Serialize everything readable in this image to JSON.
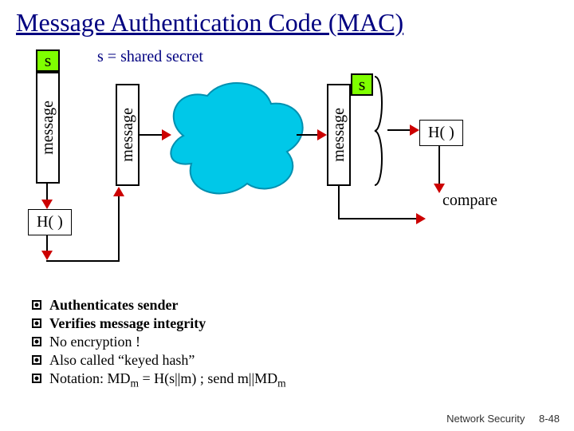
{
  "title": "Message Authentication Code (MAC)",
  "subtitle": "s = shared secret",
  "labels": {
    "s": "s",
    "message": "message",
    "hash": "H( )",
    "compare": "compare"
  },
  "bullets": [
    {
      "text": "Authenticates sender",
      "bold": true
    },
    {
      "text": "Verifies message integrity",
      "bold": true
    },
    {
      "text": "No encryption !",
      "bold": false
    },
    {
      "text": "Also called “keyed hash”",
      "bold": false
    },
    {
      "text": "Notation: MD",
      "sub": "m",
      "rest": " = H(s||m) ; send m||MD",
      "sub2": "m",
      "bold": false
    }
  ],
  "footer": {
    "left": "Network Security",
    "right": "8-48"
  }
}
